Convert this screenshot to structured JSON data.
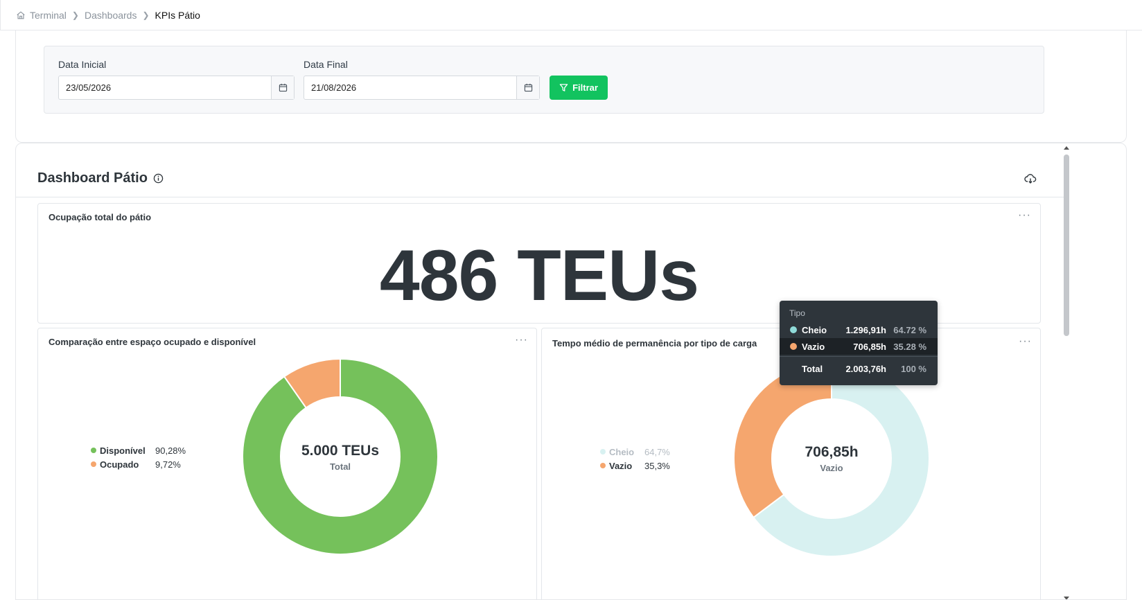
{
  "breadcrumb": {
    "items": [
      "Terminal",
      "Dashboards",
      "KPIs Pátio"
    ]
  },
  "filters": {
    "start_label": "Data Inicial",
    "start_value": "23/05/2026",
    "end_label": "Data Final",
    "end_value": "21/08/2026",
    "filter_button": "Filtrar"
  },
  "dashboard": {
    "title": "Dashboard Pátio"
  },
  "occupancy_card": {
    "title": "Ocupação total do pátio",
    "value": "486 TEUs"
  },
  "space_card": {
    "title": "Comparação entre espaço ocupado e disponível",
    "center_value": "5.000 TEUs",
    "center_label": "Total",
    "legend": [
      {
        "name": "Disponível",
        "pct": "90,28%",
        "color": "#75c15b"
      },
      {
        "name": "Ocupado",
        "pct": "9,72%",
        "color": "#f5a66e"
      }
    ]
  },
  "stay_card": {
    "title": "Tempo médio de permanência por tipo de carga",
    "center_value": "706,85h",
    "center_label": "Vazio",
    "legend": [
      {
        "name": "Cheio",
        "pct": "64,7%",
        "color": "#d8f1f1"
      },
      {
        "name": "Vazio",
        "pct": "35,3%",
        "color": "#f5a66e"
      }
    ]
  },
  "tooltip": {
    "title": "Tipo",
    "rows": [
      {
        "name": "Cheio",
        "value": "1.296,91h",
        "pct": "64.72 %",
        "color": "#8fdad8"
      },
      {
        "name": "Vazio",
        "value": "706,85h",
        "pct": "35.28 %",
        "color": "#f5a66e"
      }
    ],
    "total_label": "Total",
    "total_value": "2.003,76h",
    "total_pct": "100 %"
  },
  "chart_data": [
    {
      "type": "pie",
      "categories": [
        "Disponível",
        "Ocupado"
      ],
      "values": [
        90.28,
        9.72
      ],
      "colors": [
        "#75c15b",
        "#f5a66e"
      ],
      "title": "Comparação entre espaço ocupado e disponível"
    },
    {
      "type": "pie",
      "categories": [
        "Cheio",
        "Vazio"
      ],
      "values": [
        1296.91,
        706.85
      ],
      "colors": [
        "#d8f1f1",
        "#f5a66e"
      ],
      "title": "Tempo médio de permanência por tipo de carga"
    }
  ]
}
